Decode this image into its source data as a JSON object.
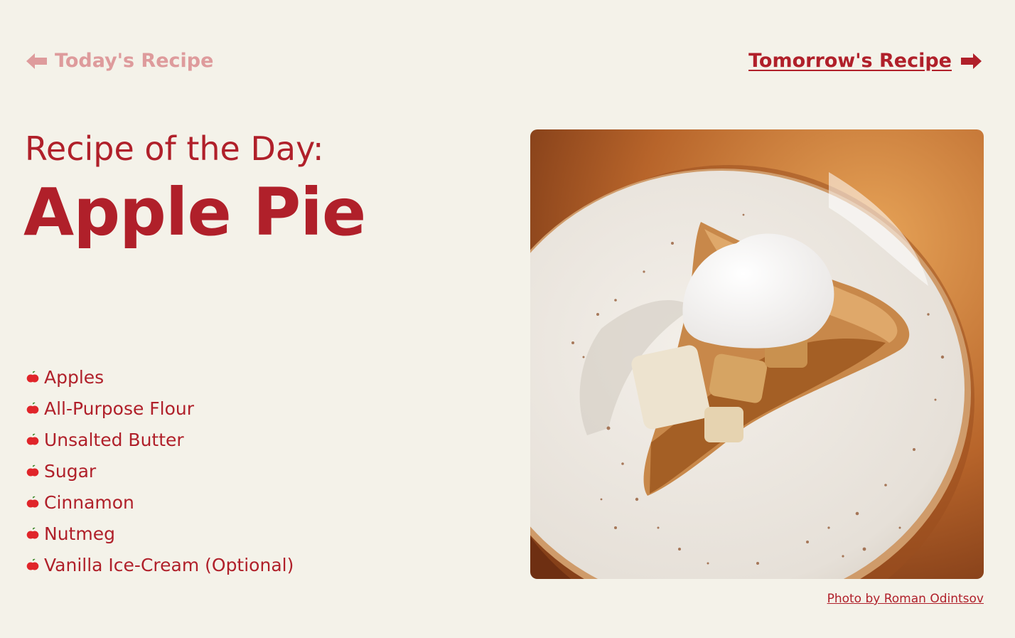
{
  "nav": {
    "prev_label": "Today's Recipe",
    "next_label": "Tomorrow's Recipe",
    "prev_icon": "arrow-left-icon",
    "next_icon": "arrow-right-icon"
  },
  "recipe": {
    "subtitle": "Recipe of the Day:",
    "title": "Apple Pie",
    "ingredients": [
      "Apples",
      "All-Purpose Flour",
      "Unsalted Butter",
      "Sugar",
      "Cinnamon",
      "Nutmeg",
      "Vanilla Ice-Cream (Optional)"
    ],
    "bullet_icon": "apple-icon"
  },
  "photo": {
    "credit": "Photo by Roman Odintsov"
  },
  "colors": {
    "background": "#f4f2e9",
    "accent": "#b0202a",
    "muted_link": "#de9b9c",
    "apple": "#e0252a"
  }
}
